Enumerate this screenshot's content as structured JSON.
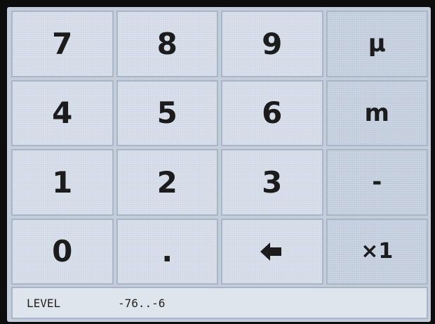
{
  "keypad": {
    "rows": [
      [
        "7",
        "8",
        "9",
        "µ"
      ],
      [
        "4",
        "5",
        "6",
        "m"
      ],
      [
        "1",
        "2",
        "3",
        "-"
      ],
      [
        "0",
        ".",
        "",
        ""
      ]
    ],
    "icons": {
      "backspace": "left-arrow-icon",
      "multiplier": "x1-multiplier"
    },
    "multiplier_label": "×1"
  },
  "status": {
    "label": "LEVEL",
    "range": "-76..-6"
  },
  "colors": {
    "key_bg": "#d0d9e5",
    "unit_key_bg": "#bfcadb",
    "grid_line": "#a7b5c6",
    "status_bg": "#dfe5ec",
    "text": "#1c1c1c"
  }
}
